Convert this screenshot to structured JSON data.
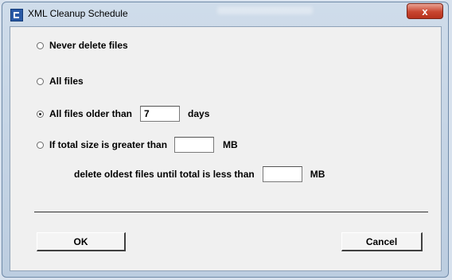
{
  "window": {
    "title": "XML Cleanup Schedule",
    "close_glyph": "x"
  },
  "options": {
    "never_delete": {
      "label": "Never delete files",
      "selected": false
    },
    "all_files": {
      "label": "All files",
      "selected": false
    },
    "older_than": {
      "label": "All files older than",
      "value": "7",
      "unit": "days",
      "selected": true
    },
    "size_limit": {
      "label": "If total size is greater than",
      "value": "",
      "unit": "MB",
      "selected": false,
      "sub_label": "delete oldest files until total is less than",
      "sub_value": "",
      "sub_unit": "MB"
    }
  },
  "buttons": {
    "ok": "OK",
    "cancel": "Cancel"
  },
  "colors": {
    "title_bar": "#cfdcea",
    "close_button": "#c8452f",
    "dialog_bg": "#f0f0f0"
  }
}
